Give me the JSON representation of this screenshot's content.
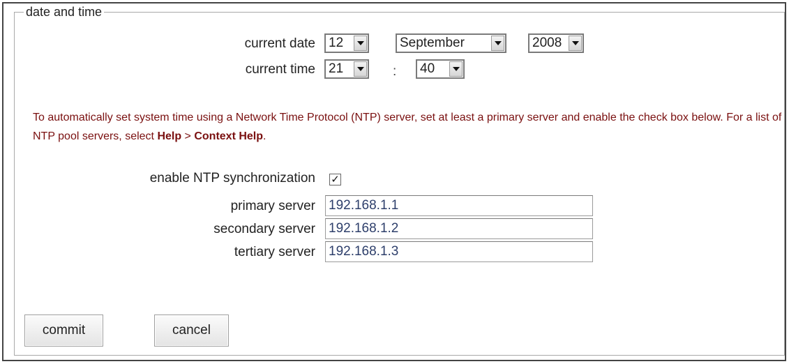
{
  "fieldset": {
    "legend": "date and time"
  },
  "date": {
    "label": "current date",
    "day": "12",
    "month": "September",
    "year": "2008"
  },
  "time": {
    "label": "current time",
    "hour": "21",
    "separator": ":",
    "minute": "40"
  },
  "notice": {
    "text_start": "To automatically set system time using a Network Time Protocol (NTP) server, set at least a primary server and enable the check box below. For a list of NTP pool servers, select ",
    "help": "Help",
    "arrow": " > ",
    "context_help": "Context Help",
    "end": "."
  },
  "ntp": {
    "enable_label": "enable NTP synchronization",
    "enabled": true,
    "check_glyph": "✓",
    "primary_label": "primary server",
    "primary_value": "192.168.1.1",
    "secondary_label": "secondary server",
    "secondary_value": "192.168.1.2",
    "tertiary_label": "tertiary server",
    "tertiary_value": "192.168.1.3"
  },
  "buttons": {
    "commit": "commit",
    "cancel": "cancel"
  }
}
